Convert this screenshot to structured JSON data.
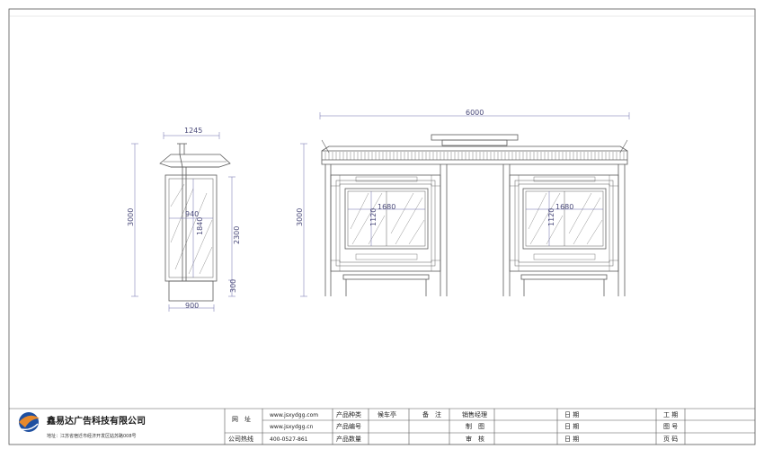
{
  "left_view": {
    "dims": {
      "top_width": "1245",
      "height": "3000",
      "inner_width": "940",
      "inner_height": "1840",
      "side_height": "2300",
      "base_height": "300",
      "bottom_width": "900"
    }
  },
  "front_view": {
    "dims": {
      "total_width": "6000",
      "height": "3000",
      "panel_left_width": "1680",
      "panel_left_height": "1120",
      "panel_right_width": "1680",
      "panel_right_height": "1120"
    }
  },
  "title_block": {
    "company_name": "鑫易达广告科技有限公司",
    "company_address": "地址：江苏省宿迁市经济开发区姑苏路008号",
    "website_label": "网　址",
    "website_1": "www.jsxydgg.com",
    "website_2": "www.jsxydgg.cn",
    "hotline_label": "公司热线",
    "hotline": "400-0527-861",
    "product_type_label": "产品种类",
    "product_type_value": "候车亭",
    "product_no_label": "产品编号",
    "product_qty_label": "产品数量",
    "remark_label": "备　注",
    "sales_manager_label": "销售经理",
    "drawn_label": "制　图",
    "review_label": "审　核",
    "date_label_1": "日 期",
    "date_label_2": "日 期",
    "date_label_3": "日 期",
    "worker_label": "工 期",
    "drawing_no_label": "图 号",
    "page_no_label": "页 码"
  },
  "colors": {
    "line": "#5a5a5a",
    "dimension": "#6a6aaa",
    "logo_blue": "#1e4fa0",
    "logo_orange": "#e8892b"
  }
}
